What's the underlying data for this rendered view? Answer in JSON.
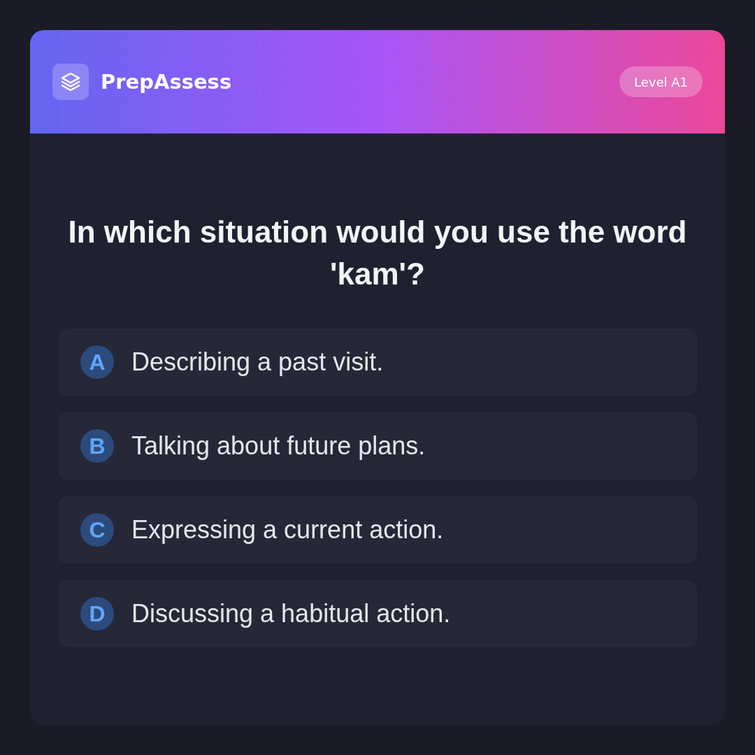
{
  "header": {
    "brand": "PrepAssess",
    "badge": "Level A1"
  },
  "question": "In which situation would you use the word 'kam'?",
  "options": [
    {
      "letter": "A",
      "text": "Describing a past visit."
    },
    {
      "letter": "B",
      "text": "Talking about future plans."
    },
    {
      "letter": "C",
      "text": "Expressing a current action."
    },
    {
      "letter": "D",
      "text": "Discussing a habitual action."
    }
  ]
}
